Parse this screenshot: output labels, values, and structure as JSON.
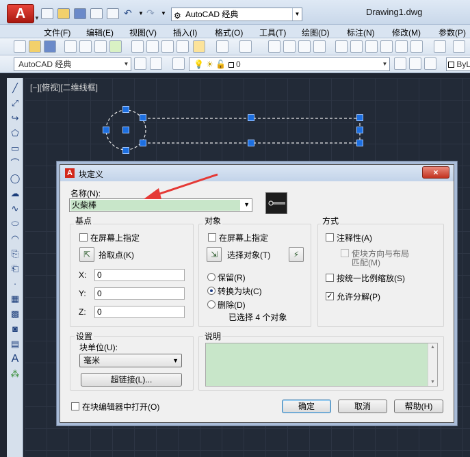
{
  "app": {
    "workspace": "AutoCAD 经典",
    "document": "Drawing1.dwg",
    "logo_letter": "A"
  },
  "menu": [
    "文件(F)",
    "编辑(E)",
    "视图(V)",
    "插入(I)",
    "格式(O)",
    "工具(T)",
    "绘图(D)",
    "标注(N)",
    "修改(M)",
    "参数(P)"
  ],
  "toolbar2": {
    "workspace": "AutoCAD 经典",
    "layer": "0",
    "bylayer": "ByL"
  },
  "viewport_label": "[−][俯视][二维线框]",
  "dialog": {
    "title": "块定义",
    "close": "×",
    "name_label": "名称(N):",
    "name_value": "火柴棒",
    "base": {
      "title": "基点",
      "on_screen": "在屏幕上指定",
      "pick": "拾取点(K)",
      "x_label": "X:",
      "x": "0",
      "y_label": "Y:",
      "y": "0",
      "z_label": "Z:",
      "z": "0"
    },
    "objects": {
      "title": "对象",
      "on_screen": "在屏幕上指定",
      "select": "选择对象(T)",
      "retain": "保留(R)",
      "convert": "转换为块(C)",
      "delete": "删除(D)",
      "count": "已选择 4 个对象"
    },
    "behavior": {
      "title": "方式",
      "annotative": "注释性(A)",
      "match_line1": "使块方向与布局",
      "match_line2": "匹配(M)",
      "uniform": "按统一比例缩放(S)",
      "explode": "允许分解(P)",
      "explode_check": "✓"
    },
    "settings": {
      "title": "设置",
      "unit_label": "块单位(U):",
      "unit_value": "毫米",
      "hyperlink": "超链接(L)..."
    },
    "description": {
      "title": "说明"
    },
    "open_in_editor": "在块编辑器中打开(O)",
    "ok": "确定",
    "cancel": "取消",
    "help": "帮助(H)"
  },
  "colors": {
    "name_field_bg": "#c8e6c9",
    "annotation_arrow": "#e53935",
    "grip": "#1d6fe0"
  }
}
